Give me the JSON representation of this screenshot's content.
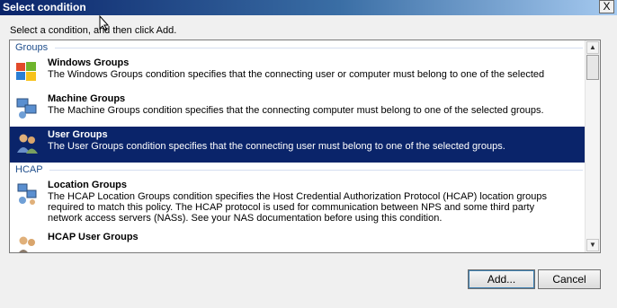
{
  "window": {
    "title": "Select condition",
    "close_label": "X"
  },
  "instruction": "Select a condition, and then click Add.",
  "list": {
    "groups": [
      {
        "header": "Groups",
        "items": [
          {
            "name": "Windows Groups",
            "icon": "windows-groups-icon",
            "desc": "The Windows Groups condition specifies that the connecting user or computer must belong to one of the selected"
          },
          {
            "name": "Machine Groups",
            "icon": "machine-groups-icon",
            "desc": "The Machine Groups condition specifies that the connecting computer must belong to one of the selected groups."
          },
          {
            "name": "User Groups",
            "icon": "user-groups-icon",
            "selected": true,
            "desc": "The User Groups condition specifies that the connecting user must belong to one of the selected groups."
          }
        ]
      },
      {
        "header": "HCAP",
        "items": [
          {
            "name": "Location Groups",
            "icon": "location-groups-icon",
            "desc": "The HCAP Location Groups condition specifies the Host Credential Authorization Protocol (HCAP) location groups required to match this policy. The HCAP protocol is used for communication between NPS and some third party network access servers (NASs). See your NAS documentation before using this condition."
          },
          {
            "name": "HCAP User Groups",
            "icon": "hcap-user-groups-icon",
            "desc": ""
          }
        ]
      }
    ]
  },
  "buttons": {
    "add": "Add...",
    "cancel": "Cancel"
  },
  "colors": {
    "title_gradient_start": "#0a246a",
    "selection": "#0a246a",
    "group_header": "#1f4e8c"
  }
}
